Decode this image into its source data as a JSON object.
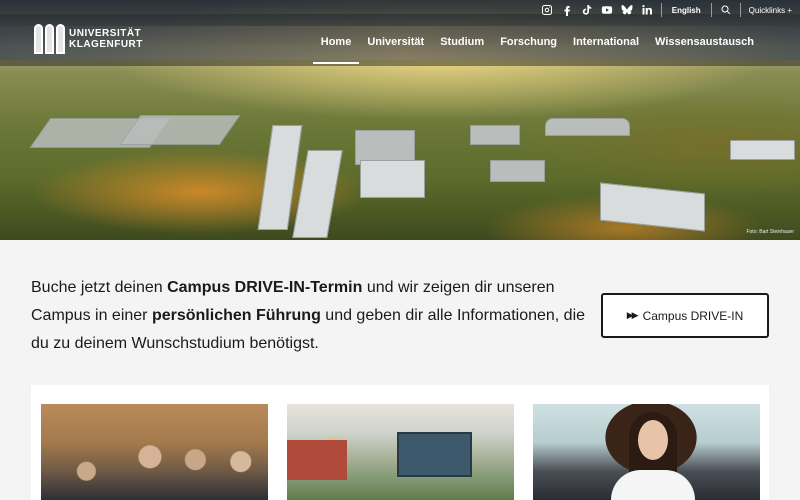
{
  "header": {
    "logo": {
      "line1": "UNIVERSITÄT",
      "line2": "KLAGENFURT"
    },
    "utility": {
      "social_icons": [
        "instagram-icon",
        "facebook-icon",
        "tiktok-icon",
        "youtube-icon",
        "bluesky-icon",
        "linkedin-icon"
      ],
      "language": "English",
      "quicklinks": "Quicklinks +"
    },
    "nav": [
      {
        "label": "Home"
      },
      {
        "label": "Universität"
      },
      {
        "label": "Studium"
      },
      {
        "label": "Forschung"
      },
      {
        "label": "International"
      },
      {
        "label": "Wissensaustausch"
      }
    ],
    "photo_credit": "Foto: Bart Steinhauer"
  },
  "info": {
    "text_1": "Buche jetzt deinen ",
    "bold_1": "Campus DRIVE-IN-Termin",
    "text_2": " und wir zeigen dir unseren Campus in einer ",
    "bold_2": "persönlichen Führung",
    "text_3": " und geben dir alle Informationen, die du zu deinem Wunschstudium benötigst.",
    "button_label": "Campus DRIVE-IN"
  },
  "colors": {
    "text": "#1a1a1a",
    "background": "#f4f4f4",
    "button_border": "#1a1a1a"
  }
}
